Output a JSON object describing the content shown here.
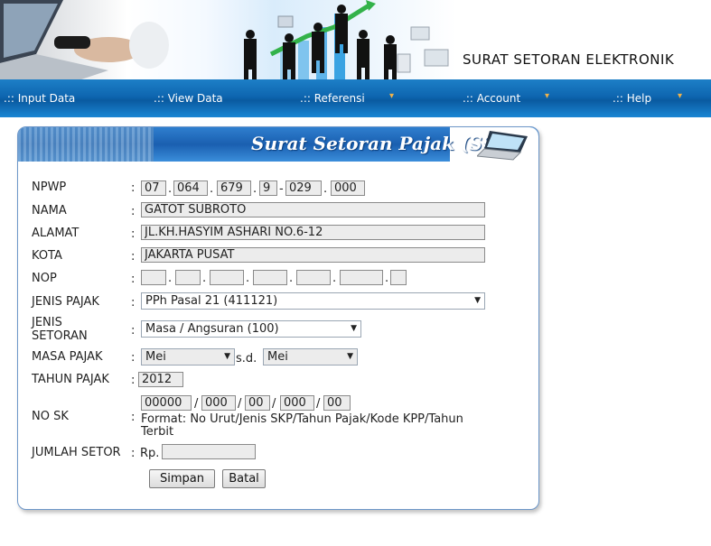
{
  "header": {
    "app_title": "SURAT SETORAN ELEKTRONIK"
  },
  "menu": {
    "items": [
      {
        "label": ".:: Input Data",
        "has_dropdown": false
      },
      {
        "label": ".:: View Data",
        "has_dropdown": false
      },
      {
        "label": ".:: Referensi",
        "has_dropdown": true
      },
      {
        "label": ".:: Account",
        "has_dropdown": true
      },
      {
        "label": ".:: Help",
        "has_dropdown": true
      }
    ],
    "dropdown_glyph": "▾"
  },
  "panel": {
    "title": "Surat Setoran Pajak (SSP)"
  },
  "form": {
    "colon": ":",
    "npwp": {
      "label": "NPWP",
      "parts": [
        "07",
        "064",
        "679",
        "9",
        "029",
        "000"
      ],
      "seps": [
        ".",
        ".",
        ".",
        "-",
        "."
      ]
    },
    "nama": {
      "label": "NAMA",
      "value": "GATOT SUBROTO"
    },
    "alamat": {
      "label": "ALAMAT",
      "value": "JL.KH.HASYIM ASHARI NO.6-12"
    },
    "kota": {
      "label": "KOTA",
      "value": "JAKARTA PUSAT"
    },
    "nop": {
      "label": "NOP",
      "parts": [
        "",
        "",
        "",
        "",
        "",
        "",
        ""
      ],
      "seps": [
        ".",
        ".",
        ".",
        ".",
        ".",
        "."
      ]
    },
    "jenis_pajak": {
      "label": "JENIS PAJAK",
      "value": "PPh Pasal 21 (411121)"
    },
    "jenis_setoran": {
      "label_line1": "JENIS",
      "label_line2": "SETORAN",
      "value": "Masa / Angsuran (100)"
    },
    "masa_pajak": {
      "label": "MASA PAJAK",
      "from": "Mei",
      "to": "Mei",
      "sd": "s.d."
    },
    "tahun_pajak": {
      "label": "TAHUN PAJAK",
      "value": "2012"
    },
    "no_sk": {
      "label": "NO SK",
      "parts": [
        "00000",
        "000",
        "00",
        "000",
        "00"
      ],
      "seps": [
        "/",
        "/",
        "/",
        "/"
      ],
      "format_line1": "Format: No Urut/Jenis SKP/Tahun Pajak/Kode KPP/Tahun",
      "format_line2": "Terbit"
    },
    "jumlah_setor": {
      "label": "JUMLAH SETOR",
      "currency": "Rp.",
      "value": ""
    },
    "buttons": {
      "save": "Simpan",
      "cancel": "Batal"
    }
  },
  "colors": {
    "menu_bg": "#0e66b0",
    "menu_accent": "#f0b24a",
    "panel_border": "#6d97c9"
  }
}
